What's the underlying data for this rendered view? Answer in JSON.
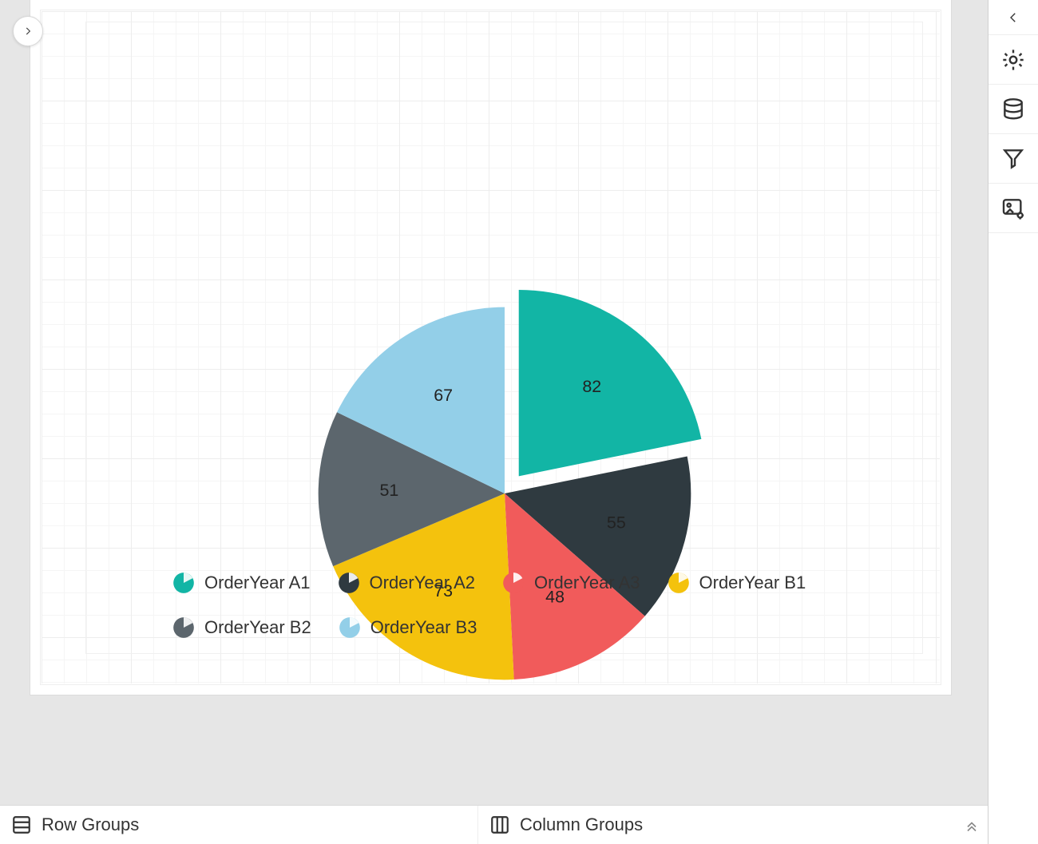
{
  "chart_data": {
    "type": "pie",
    "series": [
      {
        "name": "OrderYear A1",
        "value": 82,
        "color": "#12b5a5",
        "exploded": true
      },
      {
        "name": "OrderYear A2",
        "value": 55,
        "color": "#2f3a40"
      },
      {
        "name": "OrderYear A3",
        "value": 48,
        "color": "#f15b5b"
      },
      {
        "name": "OrderYear B1",
        "value": 73,
        "color": "#f4c20d"
      },
      {
        "name": "OrderYear B2",
        "value": 51,
        "color": "#5c666d"
      },
      {
        "name": "OrderYear B3",
        "value": 67,
        "color": "#93cfe8"
      }
    ],
    "title": "",
    "legend_position": "bottom"
  },
  "legend": [
    {
      "label": "OrderYear A1",
      "color": "#12b5a5"
    },
    {
      "label": "OrderYear A2",
      "color": "#2f3a40"
    },
    {
      "label": "OrderYear A3",
      "color": "#f15b5b"
    },
    {
      "label": "OrderYear B1",
      "color": "#f4c20d"
    },
    {
      "label": "OrderYear B2",
      "color": "#5c666d"
    },
    {
      "label": "OrderYear B3",
      "color": "#93cfe8"
    }
  ],
  "groups_bar": {
    "row_label": "Row Groups",
    "column_label": "Column Groups"
  },
  "right_rail": {
    "collapse": "collapse-panel",
    "items": [
      "settings",
      "data",
      "filter",
      "image-settings"
    ]
  }
}
